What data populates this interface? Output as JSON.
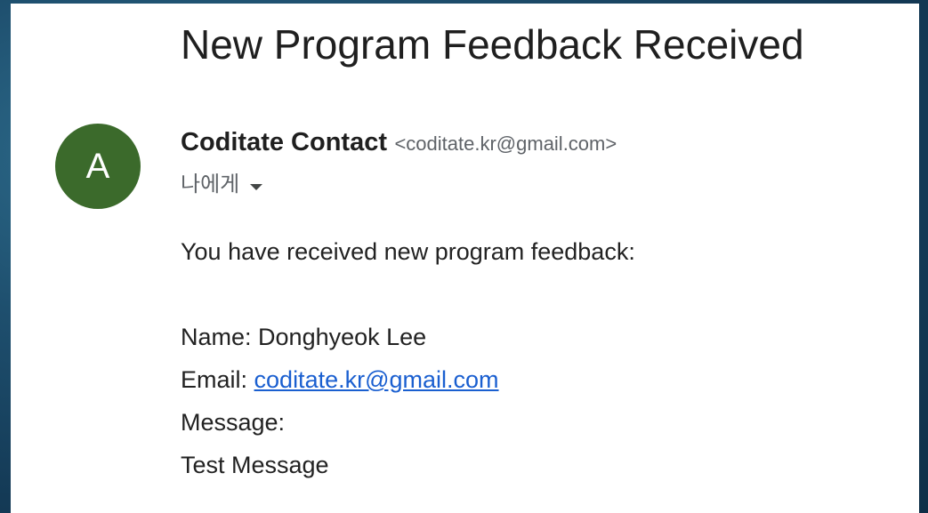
{
  "email": {
    "subject": "New Program Feedback Received",
    "avatar_letter": "A",
    "sender_name": "Coditate Contact",
    "sender_email": "<coditate.kr@gmail.com>",
    "recipient": "나에게",
    "body": {
      "intro": "You have received new program feedback:",
      "name_label": "Name:",
      "name_value": "Donghyeok Lee",
      "email_label": "Email:",
      "email_value": "coditate.kr@gmail.com",
      "message_label": "Message:",
      "message_value": "Test Message"
    }
  },
  "colors": {
    "avatar_bg": "#3b6a2b",
    "link": "#1a5fd0"
  }
}
